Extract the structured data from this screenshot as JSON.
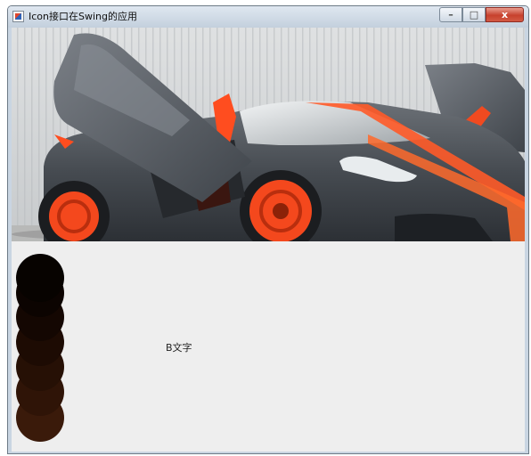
{
  "window": {
    "title": "Icon接口在Swing的应用",
    "controls": {
      "minimize": "–",
      "maximize": "□",
      "close": "x"
    }
  },
  "content": {
    "image_subject": "sports car with open doors",
    "icon": "stacked-circles-icon",
    "label": "B文字"
  },
  "colors": {
    "car_body": "#4a4f55",
    "car_accent": "#ff4a1f",
    "circle_dark": "#070300",
    "circle_light": "#3a1a0a",
    "panel": "#eeeeee"
  }
}
